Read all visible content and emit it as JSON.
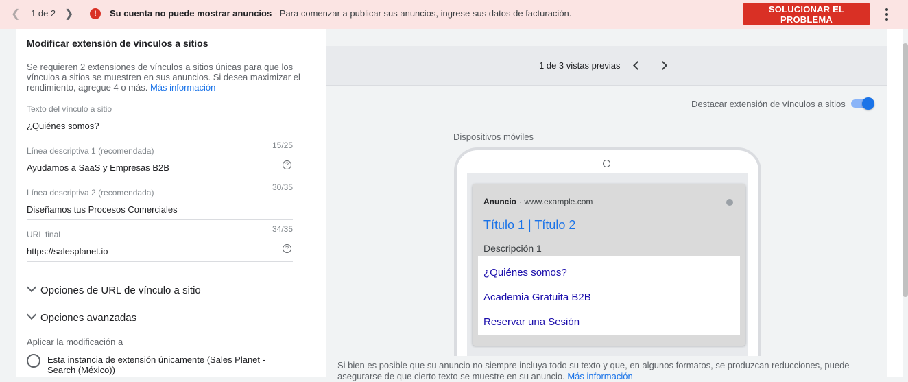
{
  "topbar": {
    "counter": "1 de 2",
    "alert_bold": "Su cuenta no puede mostrar anuncios",
    "alert_rest": " - Para comenzar a publicar sus anuncios, ingrese sus datos de facturación.",
    "fix_button": "SOLUCIONAR EL PROBLEMA",
    "alert_color": "#d93025"
  },
  "left": {
    "title": "Modificar extensión de vínculos a sitios",
    "desc": "Se requieren 2 extensiones de vínculos a sitios únicas para que los vínculos a sitios se muestren en sus anuncios. Si desea maximizar el rendimiento, agregue 4 o más.",
    "desc_link": "Más información",
    "fields": [
      {
        "label": "Texto del vínculo a sitio",
        "value": "¿Quiénes somos?",
        "count": ""
      },
      {
        "label": "Línea descriptiva 1 (recomendada)",
        "value": "Ayudamos a SaaS y Empresas B2B",
        "count": "15/25"
      },
      {
        "label": "Línea descriptiva 2 (recomendada)",
        "value": "Diseñamos tus Procesos Comerciales",
        "count": "30/35"
      },
      {
        "label": "URL final",
        "value": "https://salesplanet.io",
        "count": "34/35"
      }
    ],
    "section1": "Opciones de URL de vínculo a sitio",
    "section2": "Opciones avanzadas",
    "apply_label": "Aplicar la modificación a",
    "radio_option": "Esta instancia de extensión únicamente (Sales Planet - Search (México))"
  },
  "right": {
    "preview_count": "1 de 3 vistas previas",
    "toggle_label": "Destacar extensión de vínculos a sitios",
    "toggle_on": true,
    "device_label": "Dispositivos móviles",
    "ad": {
      "badge": "Anuncio",
      "url": "· www.example.com",
      "headline": "Título 1 | Título 2",
      "description": "Descripción 1",
      "sitelinks": [
        "¿Quiénes somos?",
        "Academia Gratuita B2B",
        "Reservar una Sesión"
      ]
    },
    "footnote": "Si bien es posible que su anuncio no siempre incluya todo su texto y que, en algunos formatos, se produzcan reducciones, puede asegurarse de que cierto texto se muestre en su anuncio.",
    "footnote_link": "Más información"
  }
}
